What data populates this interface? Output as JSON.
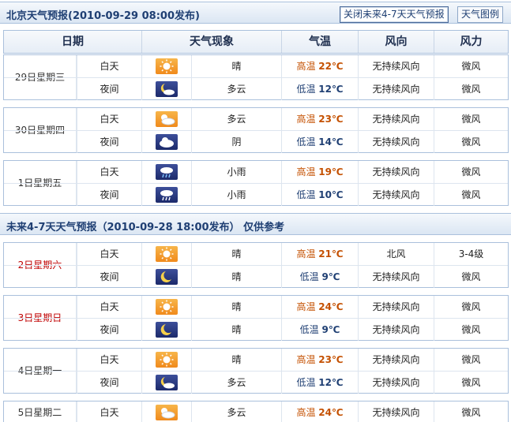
{
  "title_bar": {
    "title": "北京天气预报(2010-09-29  08:00发布)",
    "close_button": "关闭未来4-7天天气预报",
    "legend_button": "天气图例"
  },
  "headers": [
    "日期",
    "天气现象",
    "气温",
    "风向",
    "风力"
  ],
  "days_1_3": [
    {
      "date": "29日星期三",
      "weekend": false,
      "day": {
        "period": "白天",
        "icon": "sunny-icon",
        "phenomenon": "晴",
        "temp_label": "高温",
        "temp": "22℃",
        "wind_dir": "无持续风向",
        "wind_force": "微风"
      },
      "night": {
        "period": "夜间",
        "icon": "partly-cloudy-night-icon",
        "phenomenon": "多云",
        "temp_label": "低温",
        "temp": "12℃",
        "wind_dir": "无持续风向",
        "wind_force": "微风"
      }
    },
    {
      "date": "30日星期四",
      "weekend": false,
      "day": {
        "period": "白天",
        "icon": "partly-cloudy-day-icon",
        "phenomenon": "多云",
        "temp_label": "高温",
        "temp": "23℃",
        "wind_dir": "无持续风向",
        "wind_force": "微风"
      },
      "night": {
        "period": "夜间",
        "icon": "overcast-icon",
        "phenomenon": "阴",
        "temp_label": "低温",
        "temp": "14℃",
        "wind_dir": "无持续风向",
        "wind_force": "微风"
      }
    },
    {
      "date": "1日星期五",
      "weekend": false,
      "day": {
        "period": "白天",
        "icon": "light-rain-icon",
        "phenomenon": "小雨",
        "temp_label": "高温",
        "temp": "19℃",
        "wind_dir": "无持续风向",
        "wind_force": "微风"
      },
      "night": {
        "period": "夜间",
        "icon": "light-rain-night-icon",
        "phenomenon": "小雨",
        "temp_label": "低温",
        "temp": "10℃",
        "wind_dir": "无持续风向",
        "wind_force": "微风"
      }
    }
  ],
  "section2_title": "未来4-7天天气预报（2010-09-28 18:00发布）    仅供参考",
  "days_4_7": [
    {
      "date": "2日星期六",
      "weekend": true,
      "day": {
        "period": "白天",
        "icon": "sunny-icon",
        "phenomenon": "晴",
        "temp_label": "高温",
        "temp": "21℃",
        "wind_dir": "北风",
        "wind_force": "3-4级"
      },
      "night": {
        "period": "夜间",
        "icon": "clear-night-icon",
        "phenomenon": "晴",
        "temp_label": "低温",
        "temp": "9℃",
        "wind_dir": "无持续风向",
        "wind_force": "微风"
      }
    },
    {
      "date": "3日星期日",
      "weekend": true,
      "day": {
        "period": "白天",
        "icon": "sunny-icon",
        "phenomenon": "晴",
        "temp_label": "高温",
        "temp": "24℃",
        "wind_dir": "无持续风向",
        "wind_force": "微风"
      },
      "night": {
        "period": "夜间",
        "icon": "clear-night-icon",
        "phenomenon": "晴",
        "temp_label": "低温",
        "temp": "9℃",
        "wind_dir": "无持续风向",
        "wind_force": "微风"
      }
    },
    {
      "date": "4日星期一",
      "weekend": false,
      "day": {
        "period": "白天",
        "icon": "sunny-icon",
        "phenomenon": "晴",
        "temp_label": "高温",
        "temp": "23℃",
        "wind_dir": "无持续风向",
        "wind_force": "微风"
      },
      "night": {
        "period": "夜间",
        "icon": "partly-cloudy-night-icon",
        "phenomenon": "多云",
        "temp_label": "低温",
        "temp": "12℃",
        "wind_dir": "无持续风向",
        "wind_force": "微风"
      }
    },
    {
      "date": "5日星期二",
      "weekend": false,
      "day": {
        "period": "白天",
        "icon": "partly-cloudy-day-icon",
        "phenomenon": "多云",
        "temp_label": "高温",
        "temp": "24℃",
        "wind_dir": "无持续风向",
        "wind_force": "微风"
      }
    }
  ],
  "colors": {
    "accent": "#1f3f73",
    "high_temp": "#c45000",
    "weekend": "#c00000",
    "border": "#aac0dc"
  }
}
